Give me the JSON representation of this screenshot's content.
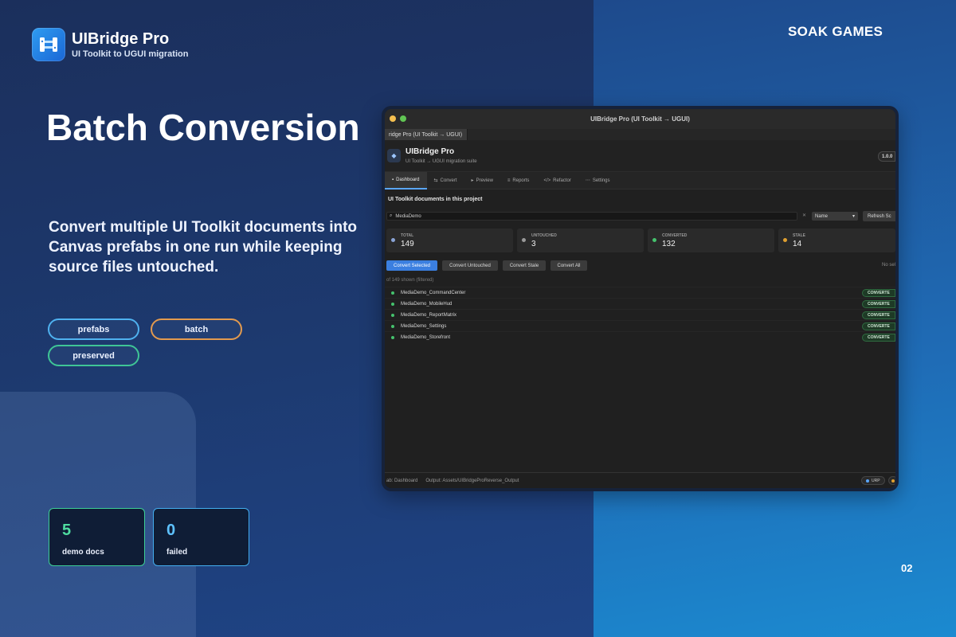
{
  "brand": {
    "title": "UIBridge Pro",
    "subtitle": "UI Toolkit to UGUI migration",
    "logo_icon": "bridge-logo-icon"
  },
  "company": "SOAK GAMES",
  "headline": "Batch Conversion",
  "description": "Convert multiple UI Toolkit documents into Canvas prefabs in one run while keeping source files untouched.",
  "tags": [
    "prefabs",
    "batch",
    "preserved"
  ],
  "stats": [
    {
      "value": "5",
      "label": "demo docs"
    },
    {
      "value": "0",
      "label": "failed"
    }
  ],
  "page_number": "02",
  "window": {
    "title": "UIBridge Pro (UI Toolkit → UGUI)",
    "doc_tab": "ridge Pro (UI Toolkit → UGUI)",
    "app_title": "UIBridge Pro",
    "app_subtitle": "UI Toolkit → UGUI migration suite",
    "version": "1.0.0",
    "nav_tabs": [
      {
        "icon": "▪",
        "label": "Dashboard"
      },
      {
        "icon": "⇆",
        "label": "Convert"
      },
      {
        "icon": "▸",
        "label": "Preview"
      },
      {
        "icon": "≡",
        "label": "Reports"
      },
      {
        "icon": "</>",
        "label": "Refactor"
      },
      {
        "icon": "⋯",
        "label": "Settings"
      }
    ],
    "section_title": "UI Toolkit documents in this project",
    "search_value": "MediaDemo",
    "clear_glyph": "✕",
    "sort_value": "Name",
    "refresh_label": "Refresh Sc",
    "stat_cards": [
      {
        "key": "TOTAL",
        "value": "149",
        "color": "#8aa4d6"
      },
      {
        "key": "UNTOUCHED",
        "value": "3",
        "color": "#9a9a9a"
      },
      {
        "key": "CONVERTED",
        "value": "132",
        "color": "#45c26d"
      },
      {
        "key": "STALE",
        "value": "14",
        "color": "#e0a030"
      }
    ],
    "actions": [
      "Convert Selected",
      "Convert Untouched",
      "Convert Stale",
      "Convert All"
    ],
    "no_selection": "No sel",
    "filter_info": "of 149 shown (filtered)",
    "rows": [
      {
        "name": "MediaDemo_CommandCenter",
        "status": "CONVERTE"
      },
      {
        "name": "MediaDemo_MobileHud",
        "status": "CONVERTE"
      },
      {
        "name": "MediaDemo_ReportMatrix",
        "status": "CONVERTE"
      },
      {
        "name": "MediaDemo_Settings",
        "status": "CONVERTE"
      },
      {
        "name": "MediaDemo_Storefront",
        "status": "CONVERTE"
      }
    ],
    "status_left": "ab: Dashboard",
    "status_output": "Output: Assets/UIBridgeProReverse_Output",
    "status_pill": "URP"
  }
}
